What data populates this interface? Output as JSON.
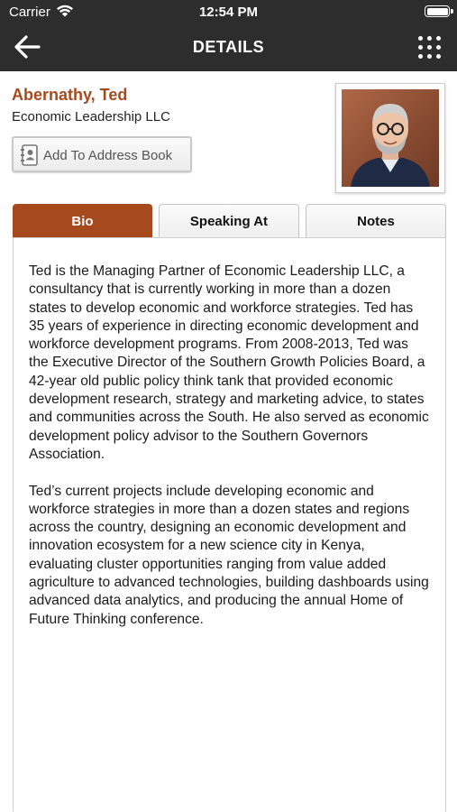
{
  "status_bar": {
    "carrier": "Carrier",
    "time": "12:54 PM",
    "battery_level": 1.0
  },
  "header": {
    "title": "DETAILS",
    "back_icon": "arrow-left-icon",
    "menu_icon": "grid-dots-icon",
    "background": "#2d2d2d"
  },
  "profile": {
    "name": "Abernathy, Ted",
    "company": "Economic Leadership LLC",
    "add_to_address_book": "Add To Address Book",
    "name_color": "#a64a1e"
  },
  "tabs": [
    {
      "label": "Bio",
      "active": true
    },
    {
      "label": "Speaking At",
      "active": false
    },
    {
      "label": "Notes",
      "active": false
    }
  ],
  "accent": "#a64a1e",
  "bio": {
    "paragraphs": [
      "Ted is the Managing Partner of Economic Leadership LLC, a consultancy that is currently working in more than a dozen states to develop economic and workforce strategies. Ted has 35 years of experience in directing economic development and workforce development programs. From 2008-2013, Ted was the Executive Director of the Southern Growth Policies Board, a 42-year old public policy think tank that provided economic development research, strategy and marketing advice, to states and communities across the South. He also served as economic development policy advisor to the Southern Governors Association.",
      "Ted’s current projects include developing economic and workforce strategies in more than a dozen states and regions across the country, designing an economic development and innovation ecosystem for a new science city in Kenya, evaluating cluster opportunities ranging from value added agriculture to advanced technologies, building dashboards using advanced data analytics, and producing the annual Home of Future Thinking conference."
    ]
  }
}
